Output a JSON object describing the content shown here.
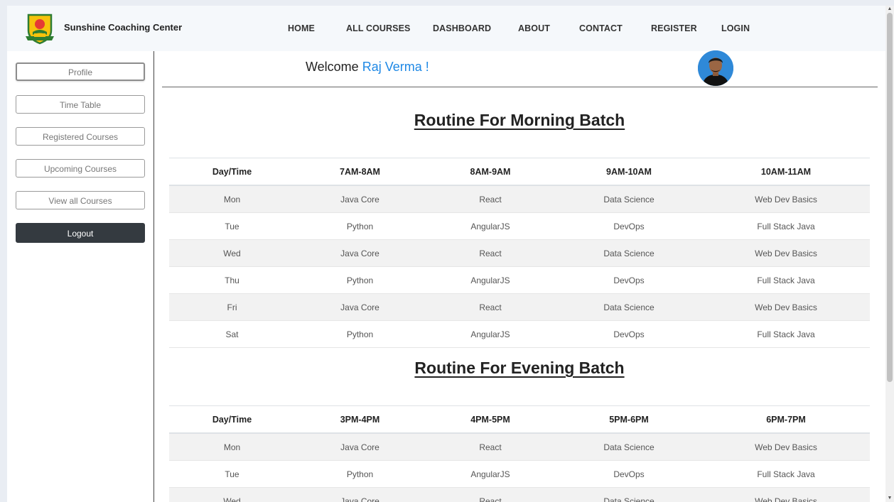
{
  "brand": {
    "name": "Sunshine Coaching Center"
  },
  "nav": [
    "HOME",
    "ALL COURSES",
    "DASHBOARD",
    "ABOUT",
    "CONTACT",
    "REGISTER",
    "LOGIN"
  ],
  "sidebar": [
    "Profile",
    "Time Table",
    "Registered Courses",
    "Upcoming Courses",
    "View all Courses",
    "Logout"
  ],
  "welcome": {
    "prefix": "Welcome",
    "name": "Raj Verma !"
  },
  "morning": {
    "title": "Routine For Morning Batch",
    "headers": [
      "Day/Time",
      "7AM-8AM",
      "8AM-9AM",
      "9AM-10AM",
      "10AM-11AM"
    ],
    "rows": [
      [
        "Mon",
        "Java Core",
        "React",
        "Data Science",
        "Web Dev Basics"
      ],
      [
        "Tue",
        "Python",
        "AngularJS",
        "DevOps",
        "Full Stack Java"
      ],
      [
        "Wed",
        "Java Core",
        "React",
        "Data Science",
        "Web Dev Basics"
      ],
      [
        "Thu",
        "Python",
        "AngularJS",
        "DevOps",
        "Full Stack Java"
      ],
      [
        "Fri",
        "Java Core",
        "React",
        "Data Science",
        "Web Dev Basics"
      ],
      [
        "Sat",
        "Python",
        "AngularJS",
        "DevOps",
        "Full Stack Java"
      ]
    ]
  },
  "evening": {
    "title": "Routine For Evening Batch",
    "headers": [
      "Day/Time",
      "3PM-4PM",
      "4PM-5PM",
      "5PM-6PM",
      "6PM-7PM"
    ],
    "rows": [
      [
        "Mon",
        "Java Core",
        "React",
        "Data Science",
        "Web Dev Basics"
      ],
      [
        "Tue",
        "Python",
        "AngularJS",
        "DevOps",
        "Full Stack Java"
      ],
      [
        "Wed",
        "Java Core",
        "React",
        "Data Science",
        "Web Dev Basics"
      ]
    ]
  },
  "icons": {
    "logo": "coaching-center-logo-icon",
    "avatar": "user-avatar-icon"
  },
  "colors": {
    "accent": "#1e88e5",
    "logout_bg": "#343a40",
    "navbar_bg": "#f5f8fb"
  }
}
